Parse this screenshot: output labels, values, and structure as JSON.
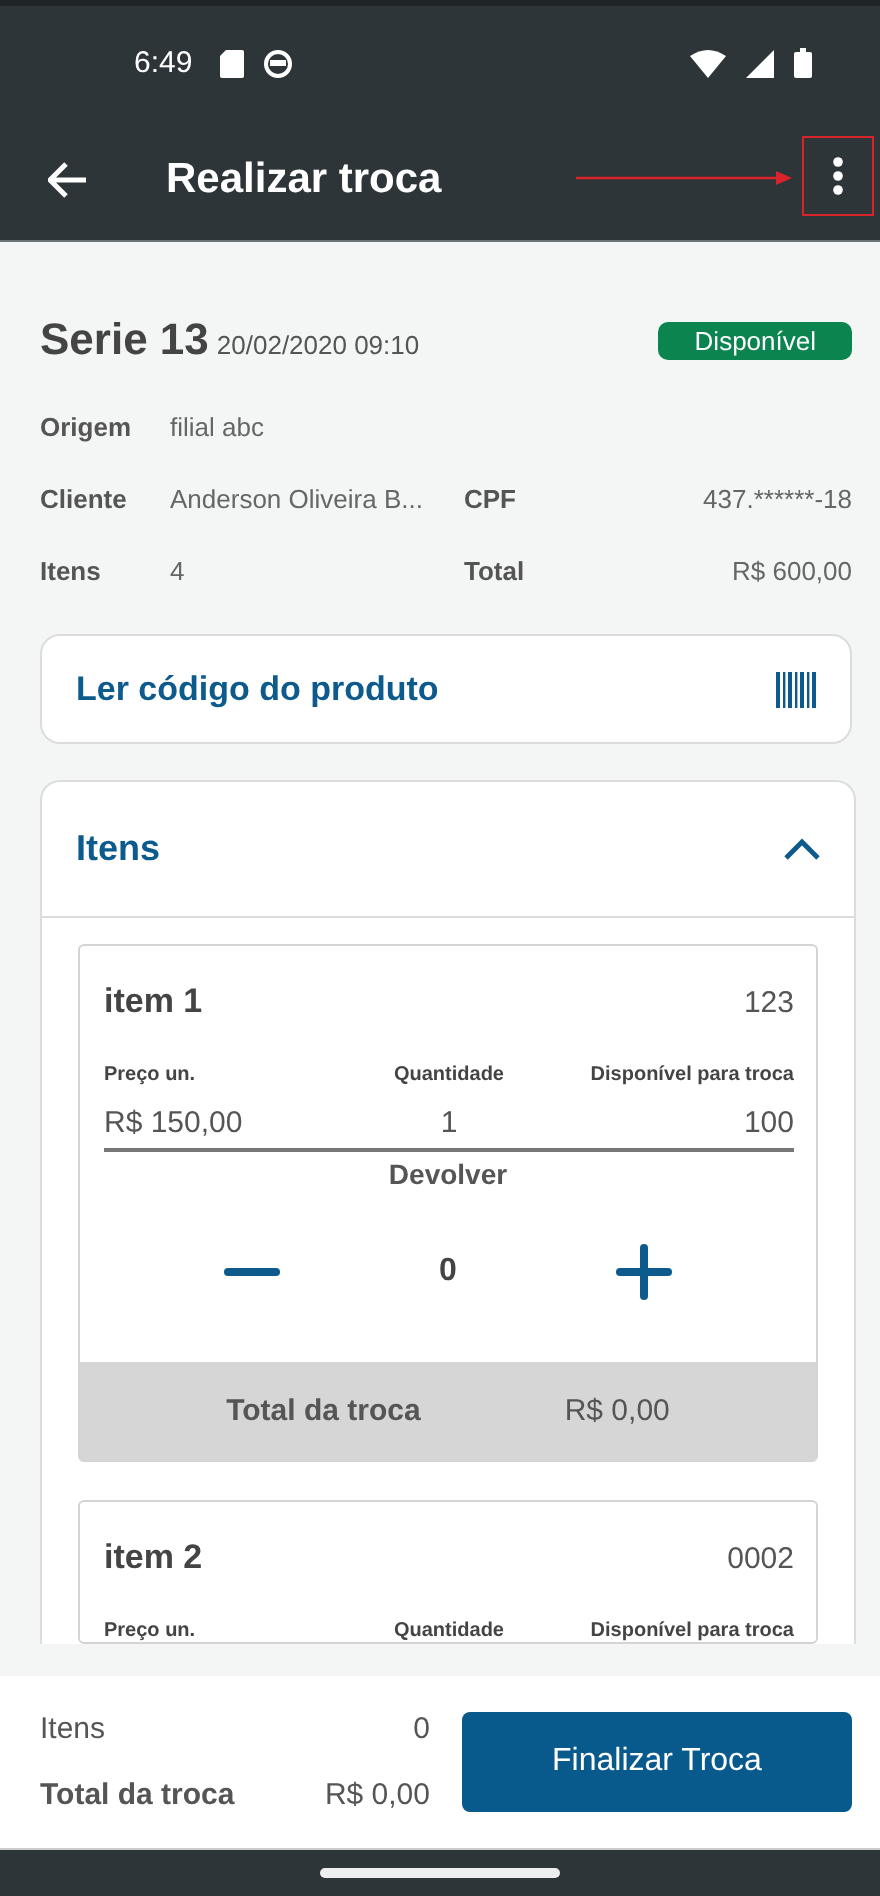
{
  "status_bar": {
    "time": "6:49"
  },
  "app_bar": {
    "title": "Realizar troca"
  },
  "header": {
    "serie": "Serie 13",
    "date": "20/02/2020 09:10",
    "status": "Disponível"
  },
  "info": [
    {
      "label": "Origem",
      "value": "filial abc"
    },
    {
      "label": "Cliente",
      "value": "Anderson Oliveira B...",
      "label2": "CPF",
      "value2": "437.******-18"
    },
    {
      "label": "Itens",
      "value": "4",
      "label2": "Total",
      "value2": "R$ 600,00"
    }
  ],
  "scan": {
    "label": "Ler código do produto"
  },
  "items_section": {
    "title": "Itens",
    "expanded": true
  },
  "items": [
    {
      "name": "item 1",
      "code": "123",
      "price_label": "Preço un.",
      "qty_label": "Quantidade",
      "avail_label": "Disponível para troca",
      "price": "R$ 150,00",
      "qty": "1",
      "avail": "100",
      "return_label": "Devolver",
      "return_qty": "0",
      "total_label": "Total da troca",
      "total": "R$ 0,00"
    },
    {
      "name": "item 2",
      "code": "0002",
      "price_label": "Preço un.",
      "qty_label": "Quantidade",
      "avail_label": "Disponível para troca"
    }
  ],
  "footer": {
    "items_label": "Itens",
    "items_value": "0",
    "total_label": "Total da troca",
    "total_value": "R$ 0,00",
    "button": "Finalizar Troca"
  }
}
